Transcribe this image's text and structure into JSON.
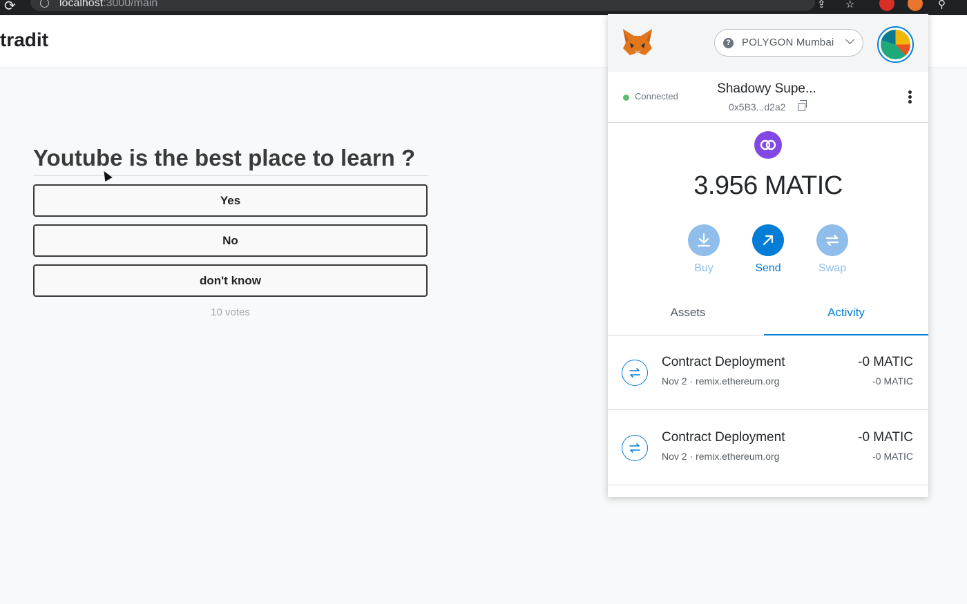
{
  "browser": {
    "url_host": "localhost",
    "url_path": ":3000/main",
    "extensions": [
      "share-icon",
      "star-icon",
      "adblock-icon",
      "metamask-icon",
      "extensions-icon"
    ]
  },
  "app": {
    "brand": "tradit"
  },
  "poll": {
    "question": "Youtube is the best place to learn ?",
    "options": [
      "Yes",
      "No",
      "don't know"
    ],
    "votes": "10 votes"
  },
  "wallet": {
    "network": "POLYGON Mumbai",
    "connection_status": "Connected",
    "account_name": "Shadowy Supe...",
    "account_address": "0x5B3...d2a2",
    "balance": "3.956 MATIC",
    "actions": {
      "buy": "Buy",
      "send": "Send",
      "swap": "Swap"
    },
    "tabs": {
      "assets": "Assets",
      "activity": "Activity"
    },
    "activity": [
      {
        "title": "Contract Deployment",
        "date": "Nov 2",
        "origin": "remix.ethereum.org",
        "amount": "-0 MATIC",
        "fiat": "-0 MATIC"
      },
      {
        "title": "Contract Deployment",
        "date": "Nov 2",
        "origin": "remix.ethereum.org",
        "amount": "-0 MATIC",
        "fiat": "-0 MATIC"
      }
    ],
    "colors": {
      "primary": "#037dd6",
      "primary_muted": "#90bdea",
      "polygon": "#8247e5",
      "connected": "#28a745"
    }
  }
}
